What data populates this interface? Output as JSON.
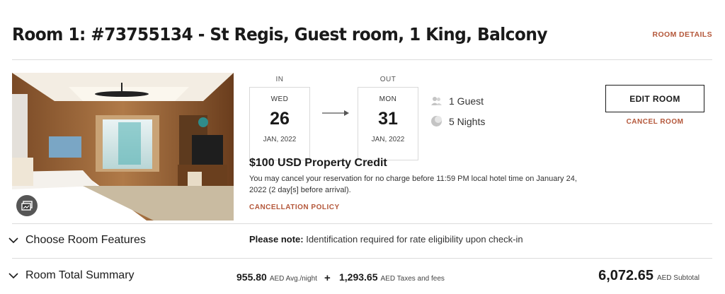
{
  "room": {
    "title": "Room 1: #73755134 - St Regis, Guest room, 1 King, Balcony",
    "details_link": "ROOM DETAILS"
  },
  "dates": {
    "in_label": "IN",
    "in_dow": "WED",
    "in_day": "26",
    "in_month_year": "JAN, 2022",
    "out_label": "OUT",
    "out_dow": "MON",
    "out_day": "31",
    "out_month_year": "JAN, 2022"
  },
  "stay": {
    "guests": "1 Guest",
    "nights": "5 Nights",
    "guests_icon": "guests-icon",
    "nights_icon": "moon-icon"
  },
  "actions": {
    "edit_room": "EDIT ROOM",
    "cancel_room": "CANCEL ROOM"
  },
  "offer": {
    "credit": "$100 USD Property Credit",
    "cancellation_text": "You may cancel your reservation for no charge before 11:59 PM local hotel time on January 24, 2022 (2 day[s] before arrival).",
    "cancellation_policy_link": "CANCELLATION POLICY"
  },
  "features": {
    "toggle_label": "Choose Room Features",
    "note_label": "Please note:",
    "note_text": " Identification required for rate eligibility upon check-in"
  },
  "summary": {
    "toggle_label": "Room Total Summary",
    "avg_nightly": "955.80",
    "avg_nightly_unit": "AED Avg./night",
    "plus": "+",
    "taxes": "1,293.65",
    "taxes_unit": "AED Taxes and fees",
    "subtotal": "6,072.65",
    "subtotal_unit": "AED Subtotal"
  },
  "colors": {
    "accent": "#b4573a",
    "text": "#1a1a1a",
    "divider": "#dcdcdc"
  }
}
